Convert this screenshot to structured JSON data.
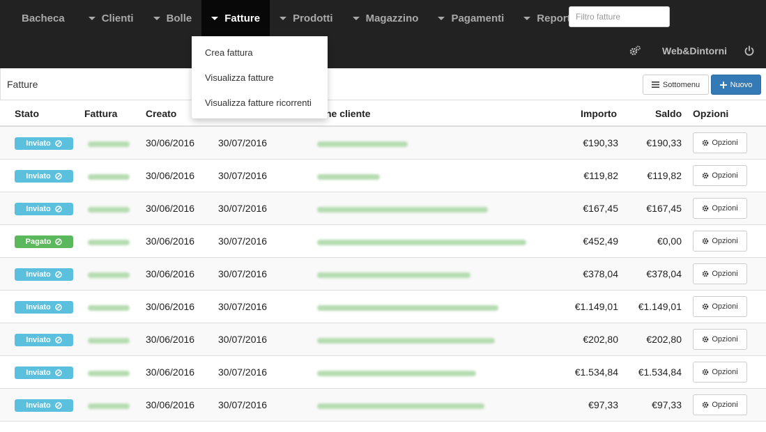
{
  "colors": {
    "navbar": "#222222",
    "active": "#080808",
    "primary": "#337ab7",
    "info": "#5bc0de",
    "success": "#5cb85c"
  },
  "nav": {
    "items": [
      {
        "label": "Bacheca",
        "caret": false
      },
      {
        "label": "Clienti",
        "caret": true
      },
      {
        "label": "Bolle",
        "caret": true
      },
      {
        "label": "Fatture",
        "caret": true,
        "active": true
      },
      {
        "label": "Prodotti",
        "caret": true
      },
      {
        "label": "Magazzino",
        "caret": true
      },
      {
        "label": "Pagamenti",
        "caret": true
      },
      {
        "label": "Report",
        "caret": true
      }
    ],
    "filter_placeholder": "Filtro fatture",
    "brand": "Web&Dintorni",
    "icons": {
      "settings": "gears-icon",
      "logout": "power-icon"
    }
  },
  "dropdown": {
    "items": [
      "Crea fattura",
      "Visualizza fatture",
      "Visualizza fatture ricorrenti"
    ]
  },
  "header": {
    "title": "Fatture",
    "submenu_label": "Sottomenu",
    "new_label": "Nuovo"
  },
  "table": {
    "columns": {
      "stato": "Stato",
      "fattura": "Fattura",
      "creato": "Creato",
      "cliente": "ne cliente",
      "importo": "Importo",
      "saldo": "Saldo",
      "opzioni": "Opzioni"
    },
    "option_label": "Opzioni",
    "rows": [
      {
        "status": "Inviato",
        "created": "30/06/2016",
        "due": "30/07/2016",
        "amount": "€190,33",
        "balance": "€190,33"
      },
      {
        "status": "Inviato",
        "created": "30/06/2016",
        "due": "30/07/2016",
        "amount": "€119,82",
        "balance": "€119,82"
      },
      {
        "status": "Inviato",
        "created": "30/06/2016",
        "due": "30/07/2016",
        "amount": "€167,45",
        "balance": "€167,45"
      },
      {
        "status": "Pagato",
        "created": "30/06/2016",
        "due": "30/07/2016",
        "amount": "€452,49",
        "balance": "€0,00"
      },
      {
        "status": "Inviato",
        "created": "30/06/2016",
        "due": "30/07/2016",
        "amount": "€378,04",
        "balance": "€378,04"
      },
      {
        "status": "Inviato",
        "created": "30/06/2016",
        "due": "30/07/2016",
        "amount": "€1.149,01",
        "balance": "€1.149,01"
      },
      {
        "status": "Inviato",
        "created": "30/06/2016",
        "due": "30/07/2016",
        "amount": "€202,80",
        "balance": "€202,80"
      },
      {
        "status": "Inviato",
        "created": "30/06/2016",
        "due": "30/07/2016",
        "amount": "€1.534,84",
        "balance": "€1.534,84"
      },
      {
        "status": "Inviato",
        "created": "30/06/2016",
        "due": "30/07/2016",
        "amount": "€97,33",
        "balance": "€97,33"
      }
    ]
  }
}
